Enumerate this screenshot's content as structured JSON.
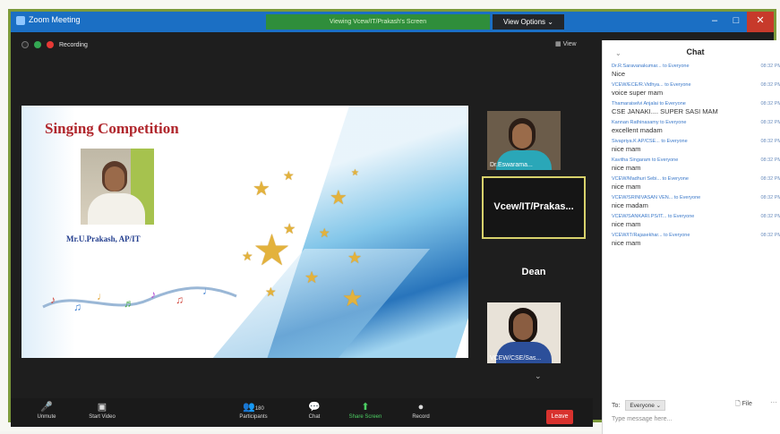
{
  "window": {
    "title": "Zoom Meeting",
    "notice": "Viewing Vcew/IT/Prakash's Screen",
    "view_options": "View Options ⌄",
    "recording": "Recording",
    "view_label": "View"
  },
  "slide": {
    "title": "Singing Competition",
    "speaker": "Mr.U.Prakash, AP/IT"
  },
  "participants": {
    "tile1_label": "Dr.Eswarama...",
    "active_name": "Vcew/IT/Prakas...",
    "dean": "Dean",
    "tile3_label": "VCEW/CSE/Sas..."
  },
  "toolbar": {
    "unmute": "Unmute",
    "start_video": "Start Video",
    "participants": "Participants",
    "participant_count": "180",
    "chat": "Chat",
    "share_screen": "Share Screen",
    "record": "Record",
    "leave": "Leave"
  },
  "chat": {
    "title": "Chat",
    "to_label": "To:",
    "recipient": "Everyone ⌄",
    "file": "File",
    "placeholder": "Type message here...",
    "messages": [
      {
        "from": "Dr.R.Saravanakumar... to Everyone",
        "time": "08:32 PM",
        "text": "Nice"
      },
      {
        "from": "VCEW/ECE/R.Vidhya... to Everyone",
        "time": "08:32 PM",
        "text": "voice super mam"
      },
      {
        "from": "Thamaraiselvi Anjalai to Everyone",
        "time": "08:32 PM",
        "text": "CSE JANAKI.... SUPER SASI MAM"
      },
      {
        "from": "Kannan Rathinasamy to Everyone",
        "time": "08:32 PM",
        "text": "excellent madam"
      },
      {
        "from": "Sivapriya.K AP/CSE... to Everyone",
        "time": "08:32 PM",
        "text": "nice mam"
      },
      {
        "from": "Kavitha Singaram to Everyone",
        "time": "08:32 PM",
        "text": "nice mam"
      },
      {
        "from": "VCEW/Madhuri Sebi... to Everyone",
        "time": "08:32 PM",
        "text": "nice mam"
      },
      {
        "from": "VCEW/SRINIVASAN VEN... to Everyone",
        "time": "08:32 PM",
        "text": "nice madam"
      },
      {
        "from": "VCEW/SANKARI.PS/IT... to Everyone",
        "time": "08:32 PM",
        "text": "nice mam"
      },
      {
        "from": "VCEW/IT/Rajasekhar... to Everyone",
        "time": "08:32 PM",
        "text": "nice mam"
      }
    ]
  }
}
